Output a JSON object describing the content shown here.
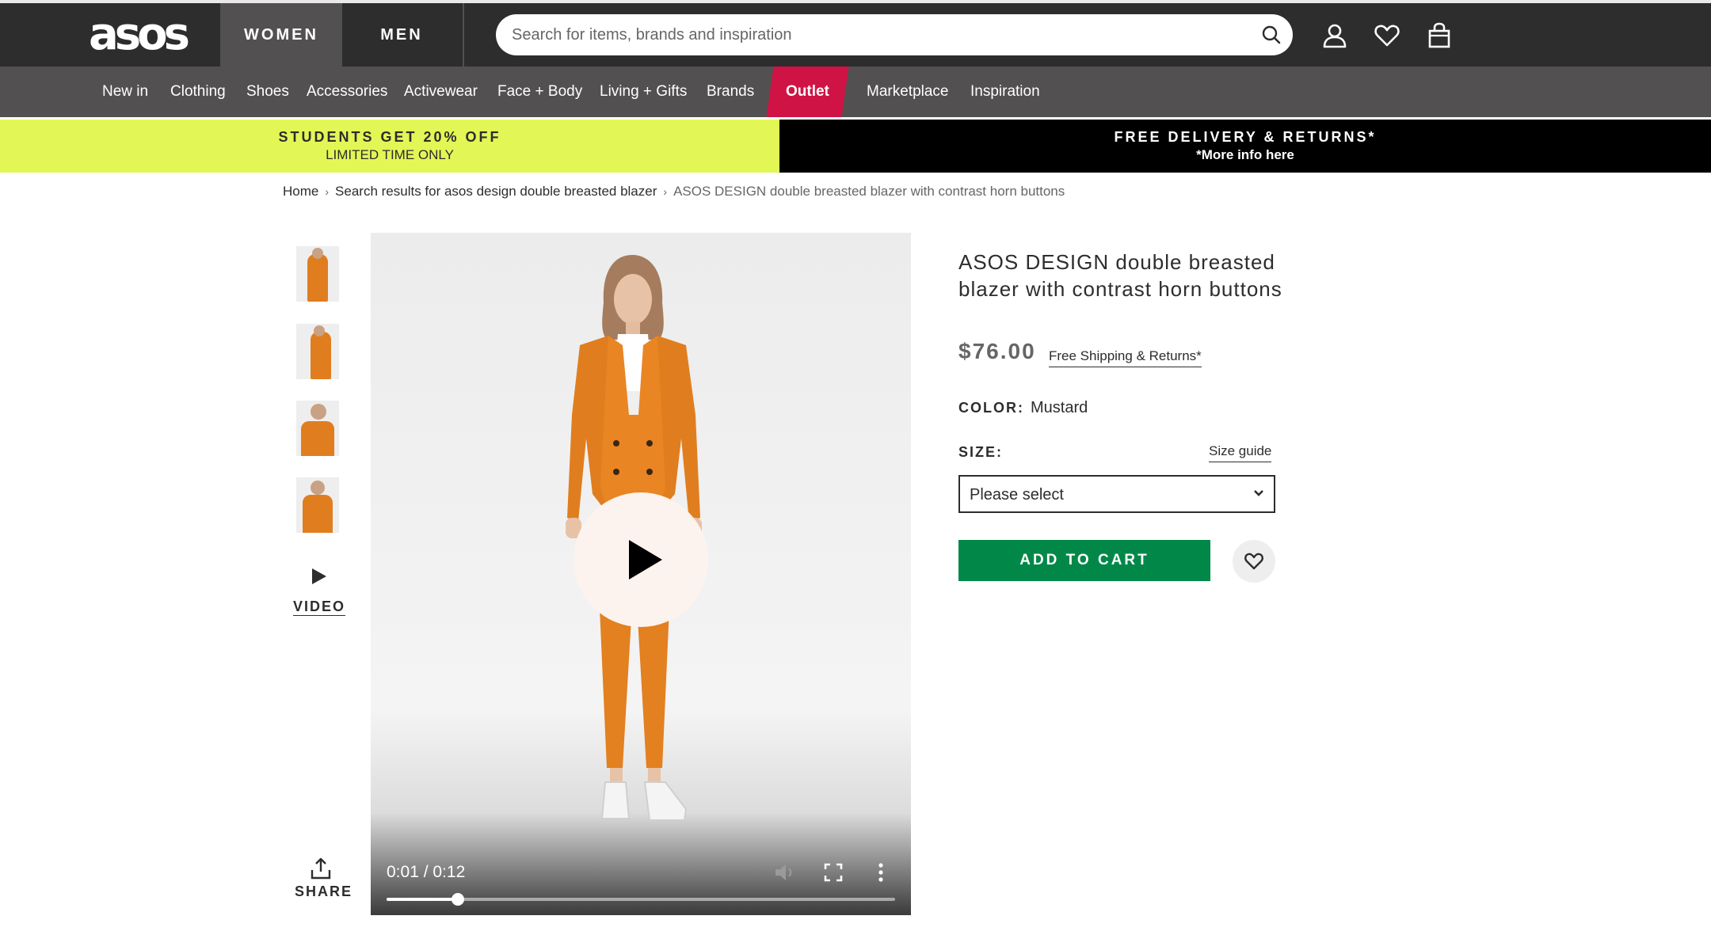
{
  "header": {
    "logo": "asos",
    "tabs": [
      "WOMEN",
      "MEN"
    ],
    "search": {
      "placeholder": "Search for items, brands and inspiration"
    },
    "icons": [
      "search-icon",
      "account-icon",
      "heart-icon",
      "bag-icon"
    ]
  },
  "nav": {
    "items": [
      "New in",
      "Clothing",
      "Shoes",
      "Accessories",
      "Activewear",
      "Face + Body",
      "Living + Gifts",
      "Brands",
      "Outlet",
      "Marketplace",
      "Inspiration"
    ]
  },
  "promo": {
    "left": {
      "title": "STUDENTS GET 20% OFF",
      "subtitle": "LIMITED TIME ONLY"
    },
    "right": {
      "title": "FREE DELIVERY & RETURNS*",
      "subtitle": "*More info here"
    }
  },
  "breadcrumb": {
    "home": "Home",
    "search": "Search results for asos design double breasted blazer",
    "current": "ASOS DESIGN double breasted blazer with contrast horn buttons"
  },
  "gallery": {
    "video_label": "VIDEO",
    "share_label": "SHARE"
  },
  "video": {
    "time": "0:01 / 0:12",
    "progress": 0.14
  },
  "product": {
    "title": "ASOS DESIGN double breasted blazer with contrast horn buttons",
    "price": "$76.00",
    "shipping": "Free Shipping & Returns*",
    "color_label": "COLOR:",
    "color_value": "Mustard",
    "size_label": "SIZE:",
    "size_guide": "Size guide",
    "size_placeholder": "Please select",
    "add_to_cart": "ADD TO CART"
  },
  "colors": {
    "header_bg": "#2d2d2d",
    "nav_bg": "#525050",
    "outlet": "#d01345",
    "promo_left": "#e2f755",
    "add_to_cart": "#018849",
    "blazer": "#e07e1f"
  }
}
